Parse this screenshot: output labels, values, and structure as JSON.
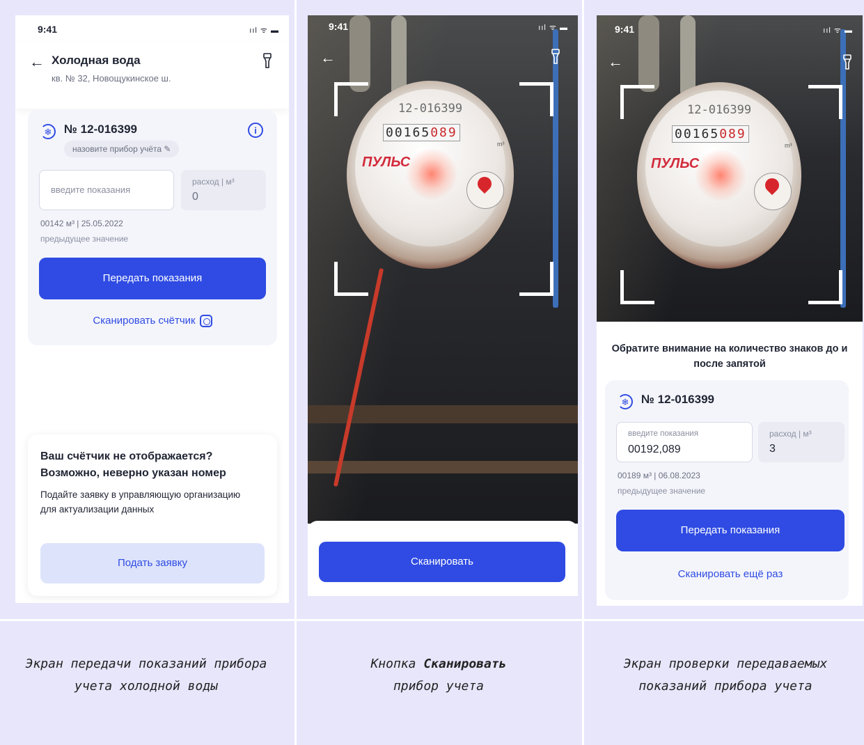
{
  "status": {
    "time": "9:41",
    "signal": "ııl ᯤ ▬"
  },
  "screen1": {
    "title": "Холодная вода",
    "subtitle": "кв. № 32, Новощукинское ш.",
    "meter_number": "№ 12-016399",
    "name_chip": "назовите прибор учёта ✎",
    "input_placeholder": "введите показания",
    "rate_label": "расход | м³",
    "rate_value": "0",
    "prev_value": "00142 м³ | 25.05.2022",
    "prev_label": "предыдущее значение",
    "submit_label": "Передать показания",
    "scan_label": "Сканировать счётчик",
    "help_heading": "Ваш счётчик не отображается? Возможно, неверно указан номер",
    "help_text": "Подайте заявку в управляющую организацию для актуализации данных",
    "help_button": "Подать заявку"
  },
  "screen2": {
    "meter_serial": "12-016399",
    "meter_digits_black": "00165",
    "meter_digits_red": "089",
    "meter_unit": "m³",
    "meter_brand": "ПУЛЬС",
    "scan_button": "Сканировать"
  },
  "screen3": {
    "hint": "Обратите внимание на количество знаков до и после запятой",
    "meter_number": "№ 12-016399",
    "input_label": "введите показания",
    "input_value": "00192,089",
    "rate_label": "расход | м³",
    "rate_value": "3",
    "prev_value": "00189 м³ | 06.08.2023",
    "prev_label": "предыдущее значение",
    "submit_label": "Передать показания",
    "rescan_label": "Сканировать ещё раз"
  },
  "captions": {
    "c1": "Экран передачи показаний прибора учета холодной воды",
    "c2_pre": "Кнопка ",
    "c2_bold": "Сканировать",
    "c2_post": "прибор учета",
    "c3": "Экран проверки передаваемых показаний прибора учета"
  },
  "colors": {
    "accent": "#2f4be3",
    "table_bg": "#e8e6fb"
  }
}
